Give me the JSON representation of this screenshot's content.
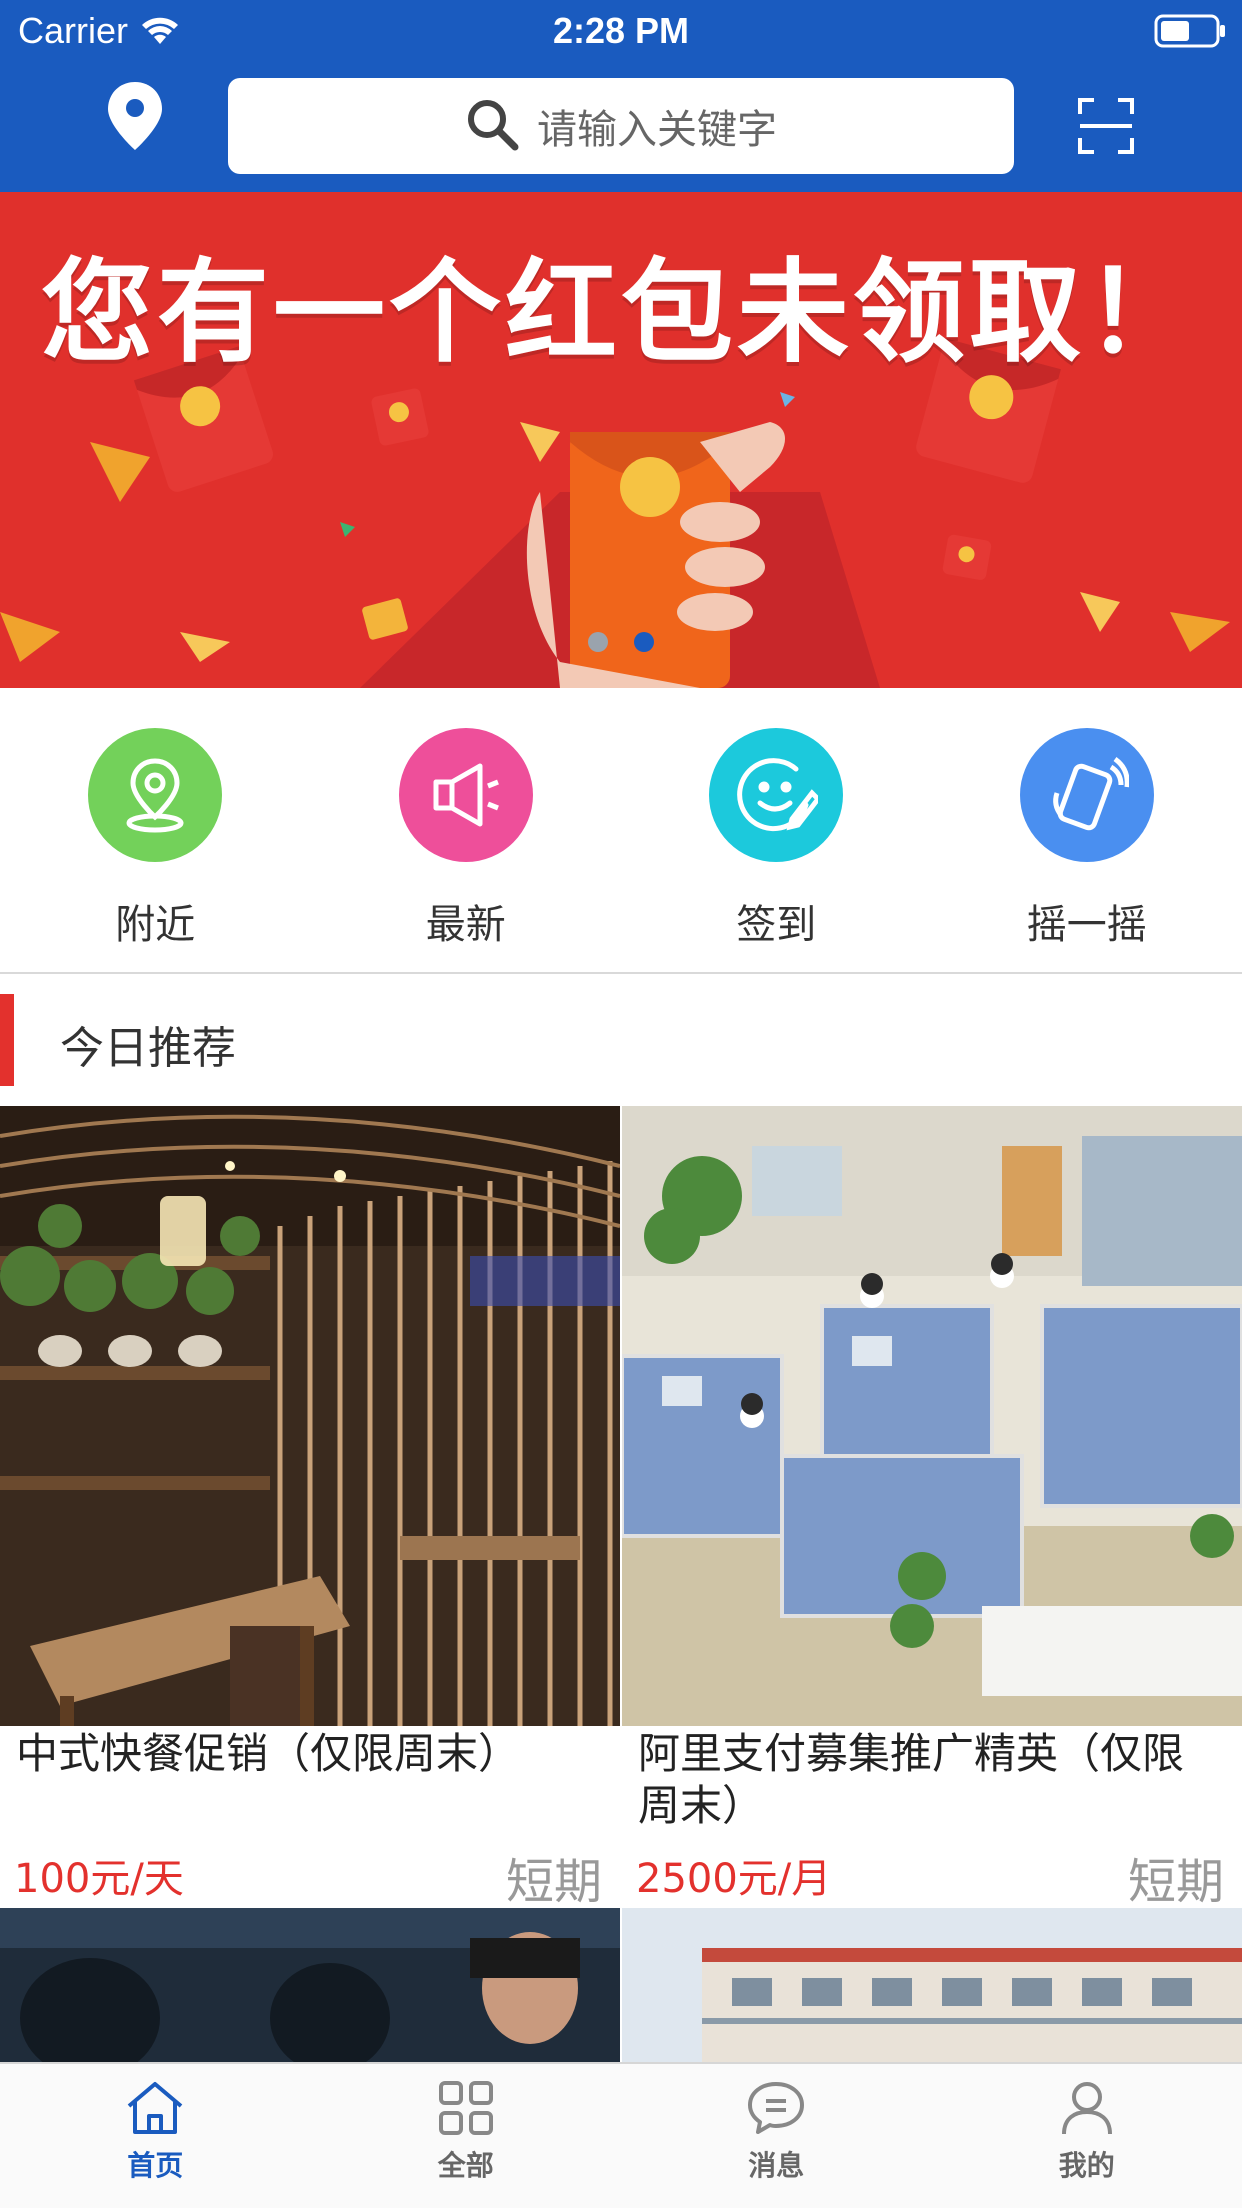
{
  "status_bar": {
    "carrier": "Carrier",
    "time": "2:28 PM"
  },
  "search": {
    "placeholder": "请输入关键字"
  },
  "banner": {
    "title": "您有一个红包未领取！",
    "slides": 2,
    "active_slide": 2,
    "colors": {
      "background": "#e0302c",
      "accent": "#f2c230"
    }
  },
  "quick_menu": [
    {
      "label": "附近",
      "icon": "location-pin-icon",
      "color": "#73d15a"
    },
    {
      "label": "最新",
      "icon": "megaphone-icon",
      "color": "#ee4f9a"
    },
    {
      "label": "签到",
      "icon": "smiley-pen-icon",
      "color": "#1cc9dc"
    },
    {
      "label": "摇一摇",
      "icon": "shake-phone-icon",
      "color": "#4a8ff0"
    }
  ],
  "section": {
    "title": "今日推荐"
  },
  "cards": [
    {
      "title": "中式快餐促销（仅限周末）",
      "price": "100元/天",
      "tag": "短期"
    },
    {
      "title": "阿里支付募集推广精英（仅限周末）",
      "price": "2500元/月",
      "tag": "短期"
    }
  ],
  "tabs": [
    {
      "label": "首页",
      "icon": "home-icon",
      "active": true
    },
    {
      "label": "全部",
      "icon": "grid-icon",
      "active": false
    },
    {
      "label": "消息",
      "icon": "chat-bubble-icon",
      "active": false
    },
    {
      "label": "我的",
      "icon": "user-icon",
      "active": false
    }
  ],
  "colors": {
    "primary": "#1a5bbf",
    "accent_red": "#e3312d"
  }
}
